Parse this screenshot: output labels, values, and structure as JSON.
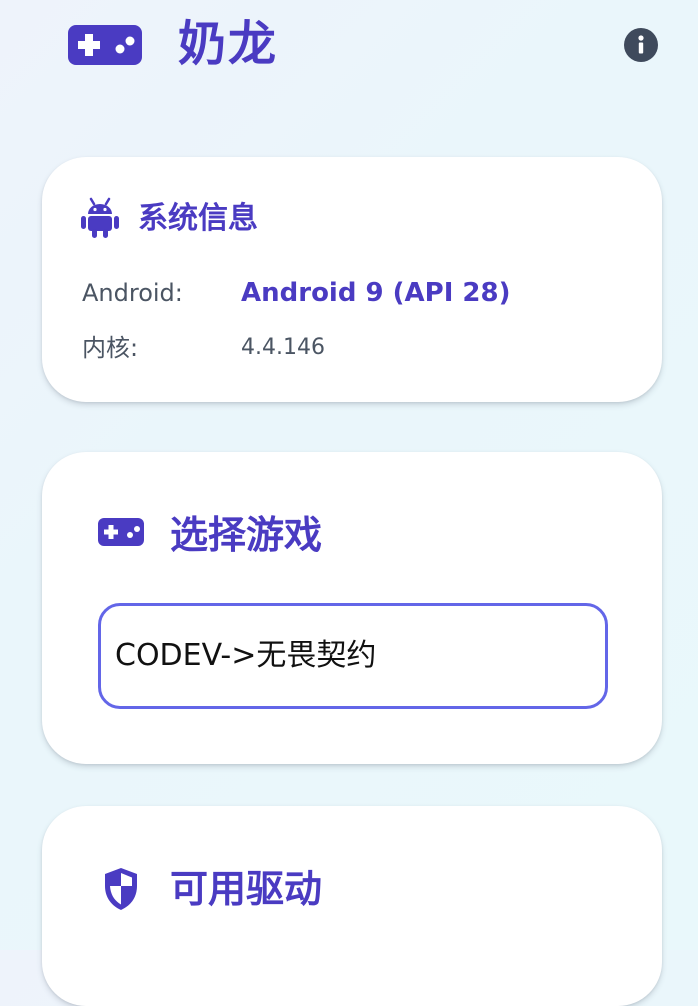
{
  "header": {
    "title": "奶龙",
    "logo_icon": "gamepad-icon",
    "info_icon": "info-icon"
  },
  "system_info": {
    "title": "系统信息",
    "icon": "android-icon",
    "rows": [
      {
        "label": "Android:",
        "value": "Android 9 (API 28)"
      },
      {
        "label": "内核:",
        "value": "4.4.146"
      }
    ]
  },
  "game_select": {
    "title": "选择游戏",
    "icon": "gamepad-icon",
    "selected": "CODEV->无畏契约"
  },
  "drivers": {
    "title": "可用驱动",
    "icon": "shield-icon"
  },
  "colors": {
    "accent": "#4a3bc2",
    "select_border": "#6366e8",
    "info_button": "#3f4a5c"
  }
}
